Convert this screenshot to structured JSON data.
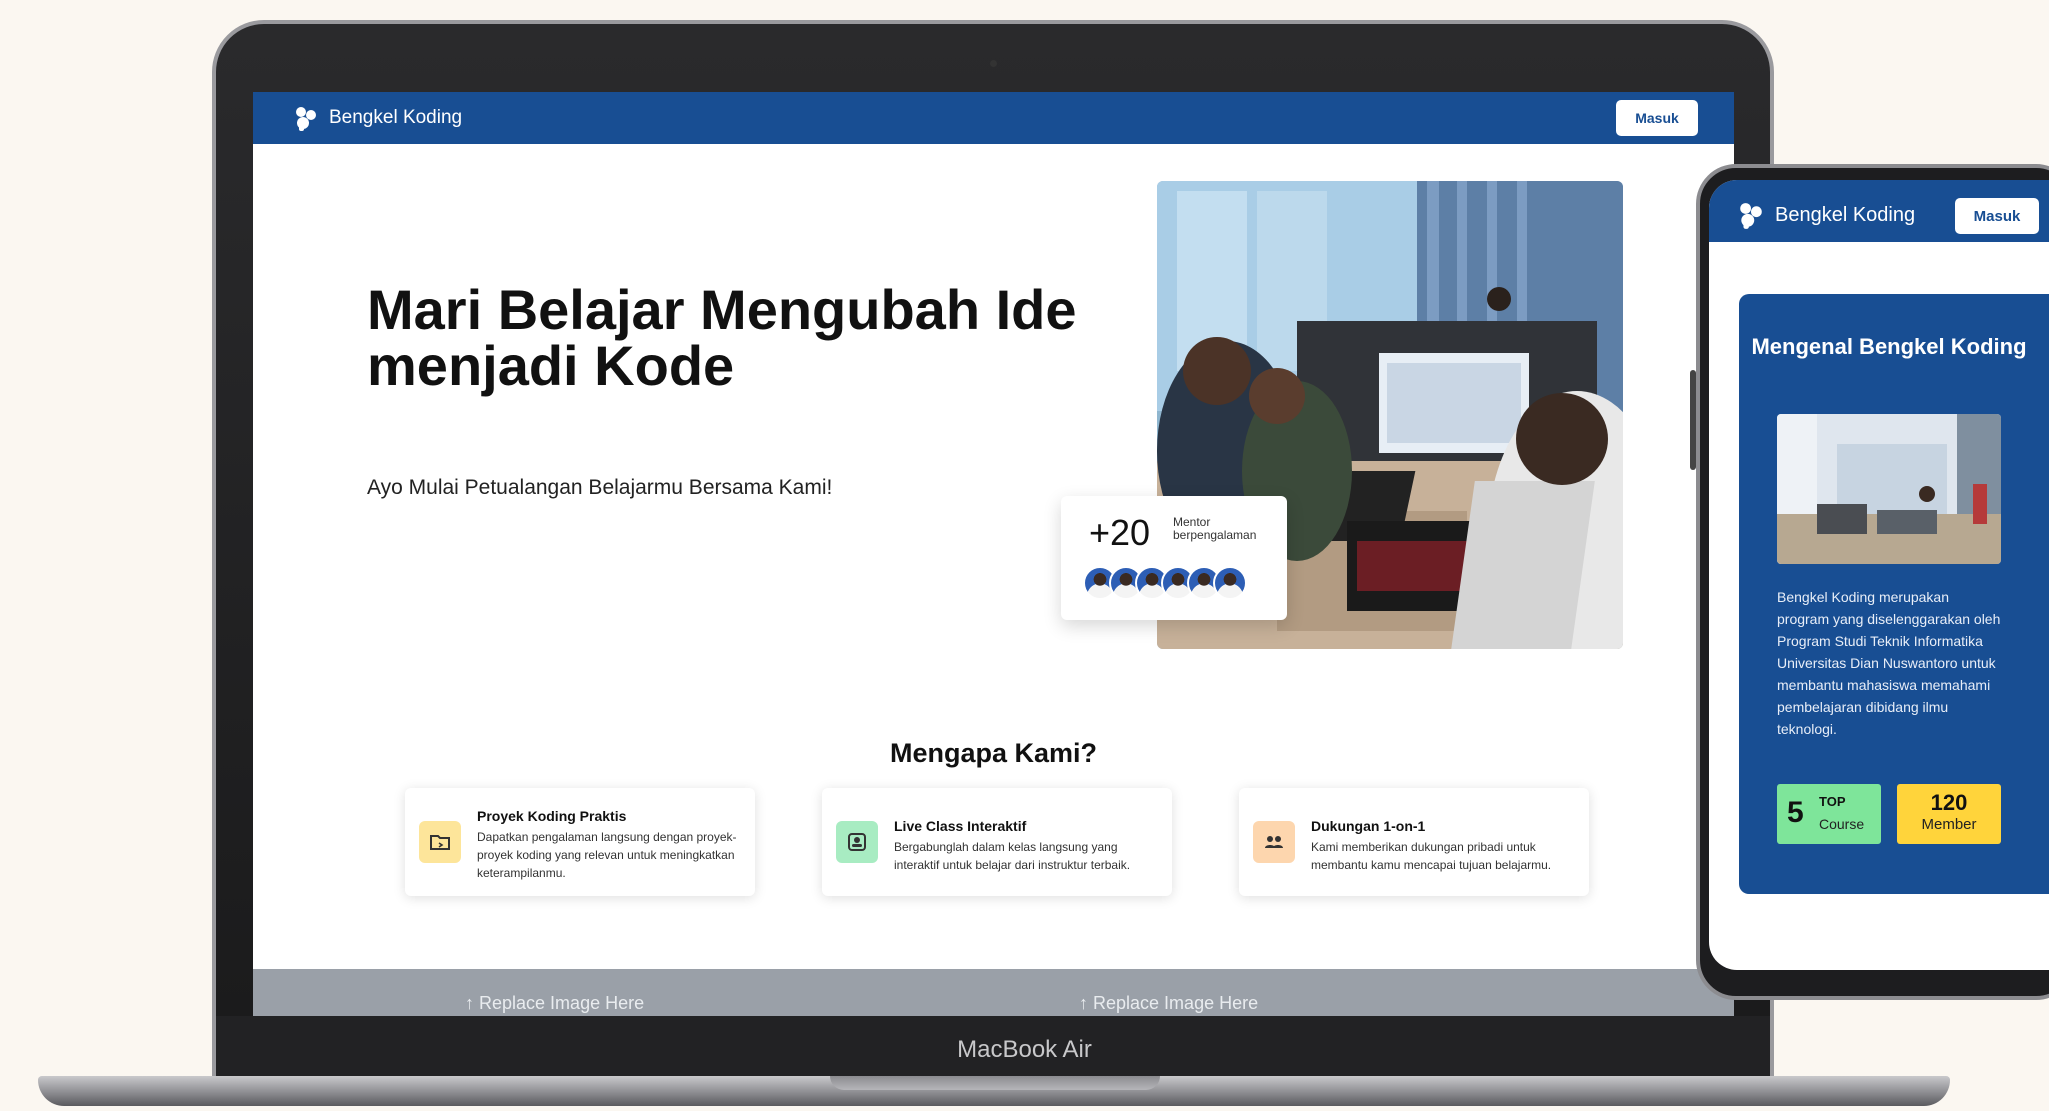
{
  "laptop": {
    "device_label": "MacBook Air",
    "navbar": {
      "brand": "Bengkel Koding",
      "login_label": "Masuk"
    },
    "hero": {
      "title_line1": "Mari Belajar Mengubah Ide",
      "title_line2": "menjadi Kode",
      "subtitle": "Ayo Mulai Petualangan Belajarmu Bersama Kami!"
    },
    "mentor_badge": {
      "count": "+20",
      "label_line1": "Mentor",
      "label_line2": "berpengalaman"
    },
    "why_section": {
      "title": "Mengapa Kami?",
      "features": [
        {
          "title": "Proyek Koding Praktis",
          "desc": "Dapatkan pengalaman langsung dengan proyek-proyek koding yang relevan untuk meningkatkan keterampilanmu.",
          "icon": "folder-code-icon",
          "color": "#fde59a"
        },
        {
          "title": "Live Class Interaktif",
          "desc": "Bergabunglah dalam kelas langsung yang interaktif untuk belajar dari instruktur terbaik.",
          "icon": "video-class-icon",
          "color": "#a8ecc2"
        },
        {
          "title": "Dukungan 1-on-1",
          "desc": "Kami memberikan dukungan pribadi untuk membantu kamu mencapai tujuan belajarmu.",
          "icon": "people-support-icon",
          "color": "#fdd6ae"
        }
      ]
    },
    "placeholders": [
      "Replace Image Here",
      "Replace Image Here"
    ]
  },
  "phone": {
    "navbar": {
      "brand": "Bengkel Koding",
      "login_label": "Masuk"
    },
    "card": {
      "title": "Mengenal Bengkel Koding",
      "description": "Bengkel Koding merupakan program yang diselenggarakan oleh Program Studi Teknik Informatika Universitas Dian Nuswantoro untuk membantu mahasiswa memahami pembelajaran dibidang ilmu teknologi.",
      "stats": [
        {
          "value": "5",
          "tag": "TOP",
          "label": "Course",
          "color": "#7ee59a"
        },
        {
          "value": "120",
          "label": "Member",
          "color": "#ffd43b"
        }
      ]
    }
  },
  "colors": {
    "brand_blue": "#184e93",
    "background": "#fbf7f1"
  }
}
